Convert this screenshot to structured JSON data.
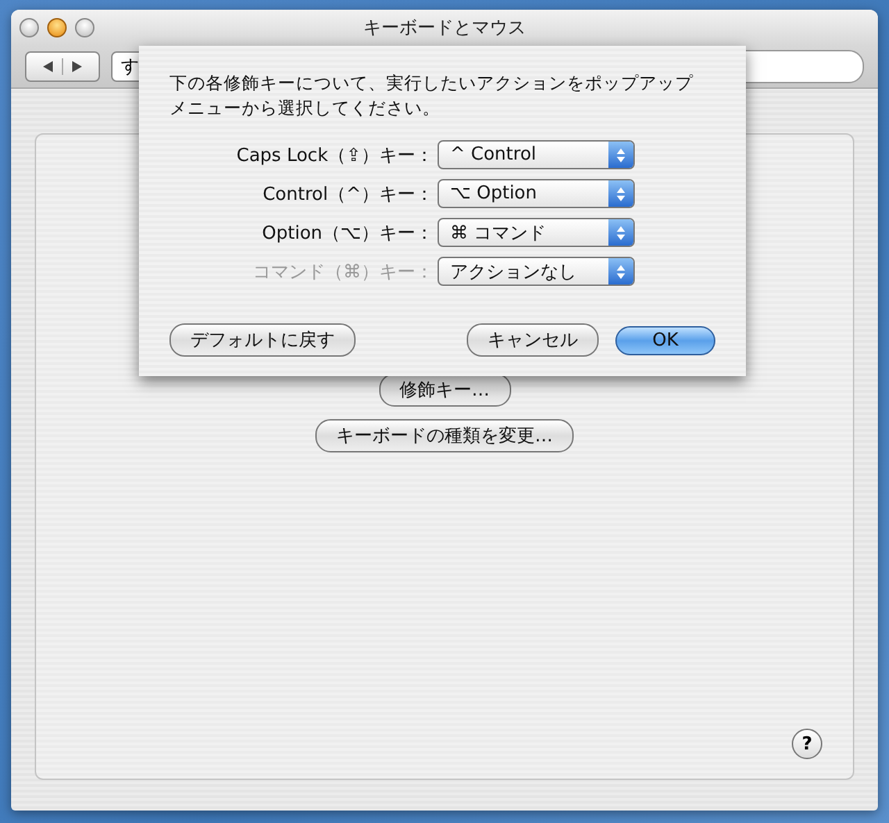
{
  "window": {
    "title": "キーボードとマウス"
  },
  "toolbar": {
    "show_all_button": "す"
  },
  "sheet": {
    "message": "下の各修飾キーについて、実行したいアクションをポップアップメニューから選択してください。",
    "rows": [
      {
        "label": "Caps Lock（⇪）キー：",
        "value": "^ Control",
        "disabled": false
      },
      {
        "label": "Control（^）キー：",
        "value": "⌥ Option",
        "disabled": false
      },
      {
        "label": "Option（⌥）キー：",
        "value": "⌘ コマンド",
        "disabled": false
      },
      {
        "label": "コマンド（⌘）キー：",
        "value": "アクションなし",
        "disabled": true
      }
    ],
    "buttons": [
      {
        "label": "デフォルトに戻す",
        "kind": "normal"
      },
      {
        "label": "キャンセル",
        "kind": "normal"
      },
      {
        "label": "OK",
        "kind": "default"
      }
    ]
  },
  "panel": {
    "modifier_button": "修飾キー…",
    "keyboard_type_button": "キーボードの種類を変更…",
    "help": "?"
  }
}
